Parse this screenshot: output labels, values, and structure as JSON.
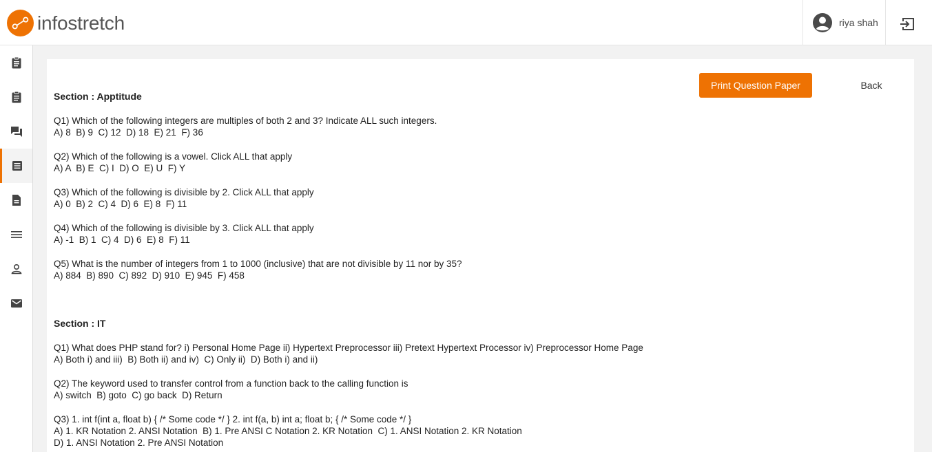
{
  "header": {
    "logo_text": "infostretch",
    "user_name": "riya shah",
    "brand_color": "#ee7203"
  },
  "sidebar": {
    "items": [
      {
        "icon": "clipboard-icon"
      },
      {
        "icon": "clipboard-icon"
      },
      {
        "icon": "forum-icon"
      },
      {
        "icon": "document-list-icon",
        "active": true
      },
      {
        "icon": "file-icon"
      },
      {
        "icon": "menu-lines-icon"
      },
      {
        "icon": "person-icon"
      },
      {
        "icon": "mail-icon"
      }
    ]
  },
  "toolbar": {
    "print_label": "Print Question Paper",
    "back_label": "Back"
  },
  "sections": [
    {
      "title": "Section : Apptitude",
      "questions": [
        {
          "q": "Q1) Which of the following integers are multiples of both 2 and 3? Indicate ALL such integers.",
          "options": [
            "A) 8  B) 9  C) 12  D) 18  E) 21  F) 36"
          ]
        },
        {
          "q": "Q2) Which of the following is a vowel. Click ALL that apply",
          "options": [
            "A) A  B) E  C) I  D) O  E) U  F) Y"
          ]
        },
        {
          "q": "Q3) Which of the following is divisible by 2. Click ALL that apply",
          "options": [
            "A) 0  B) 2  C) 4  D) 6  E) 8  F) 11"
          ]
        },
        {
          "q": "Q4) Which of the following is divisible by 3. Click ALL that apply",
          "options": [
            "A) -1  B) 1  C) 4  D) 6  E) 8  F) 11"
          ]
        },
        {
          "q": "Q5) What is the number of integers from 1 to 1000 (inclusive) that are not divisible by 11 nor by 35?",
          "options": [
            "A) 884  B) 890  C) 892  D) 910  E) 945  F) 458"
          ]
        }
      ]
    },
    {
      "title": "Section : IT",
      "questions": [
        {
          "q": "Q1) What does PHP stand for? i) Personal Home Page ii) Hypertext Preprocessor iii) Pretext Hypertext Processor iv) Preprocessor Home Page",
          "options": [
            "A) Both i) and iii)  B) Both ii) and iv)  C) Only ii)  D) Both i) and ii)"
          ]
        },
        {
          "q": "Q2) The keyword used to transfer control from a function back to the calling function is",
          "options": [
            "A) switch  B) goto  C) go back  D) Return"
          ]
        },
        {
          "q": "Q3) 1. int f(int a, float b) { /* Some code */ } 2. int f(a, b) int a; float b; { /* Some code */ }",
          "options": [
            "A) 1. KR Notation 2. ANSI Notation  B) 1. Pre ANSI C Notation 2. KR Notation  C) 1. ANSI Notation 2. KR Notation",
            "D) 1. ANSI Notation 2. Pre ANSI Notation"
          ]
        }
      ]
    }
  ]
}
